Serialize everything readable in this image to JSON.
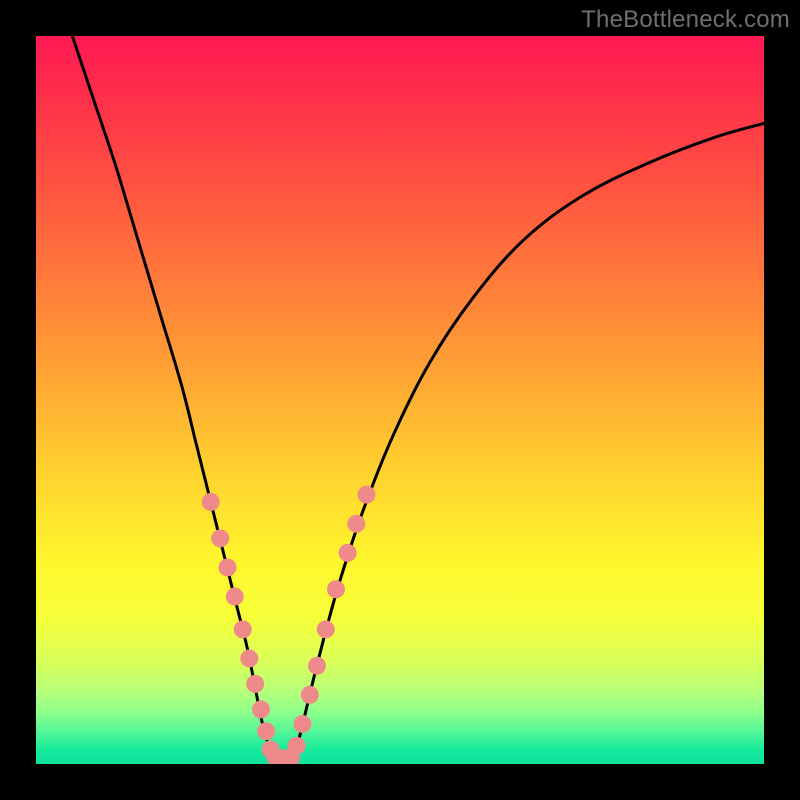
{
  "watermark": "TheBottleneck.com",
  "chart_data": {
    "type": "line",
    "title": "",
    "xlabel": "",
    "ylabel": "",
    "xlim": [
      0,
      100
    ],
    "ylim": [
      0,
      100
    ],
    "grid": false,
    "legend": false,
    "background": "rainbow-gradient",
    "series": [
      {
        "name": "bottleneck-curve-left",
        "x": [
          5,
          8,
          11,
          14,
          17,
          20,
          22,
          24,
          26,
          27.5,
          29,
          30.2,
          31,
          31.8,
          32.4
        ],
        "y": [
          100,
          91,
          82,
          72,
          62,
          52,
          44,
          36,
          28,
          22,
          16,
          10,
          6,
          3,
          0.8
        ]
      },
      {
        "name": "bottleneck-curve-right",
        "x": [
          35.2,
          36,
          37,
          38.2,
          40,
          42,
          45,
          49,
          54,
          60,
          67,
          75,
          84,
          93,
          100
        ],
        "y": [
          0.8,
          3,
          7,
          12,
          19,
          26,
          35,
          45,
          55,
          64,
          72,
          78,
          82.5,
          86,
          88
        ]
      },
      {
        "name": "flat-bottom",
        "x": [
          32.4,
          35.2
        ],
        "y": [
          0.8,
          0.8
        ]
      }
    ],
    "markers": {
      "name": "highlight-dots",
      "color": "#ef8a8a",
      "points": [
        {
          "x": 24.0,
          "y": 36.0
        },
        {
          "x": 25.3,
          "y": 31.0
        },
        {
          "x": 26.3,
          "y": 27.0
        },
        {
          "x": 27.3,
          "y": 23.0
        },
        {
          "x": 28.4,
          "y": 18.5
        },
        {
          "x": 29.3,
          "y": 14.5
        },
        {
          "x": 30.1,
          "y": 11.0
        },
        {
          "x": 30.9,
          "y": 7.5
        },
        {
          "x": 31.6,
          "y": 4.5
        },
        {
          "x": 32.2,
          "y": 2.0
        },
        {
          "x": 32.9,
          "y": 0.9
        },
        {
          "x": 34.0,
          "y": 0.8
        },
        {
          "x": 35.0,
          "y": 0.9
        },
        {
          "x": 35.8,
          "y": 2.5
        },
        {
          "x": 36.6,
          "y": 5.5
        },
        {
          "x": 37.6,
          "y": 9.5
        },
        {
          "x": 38.6,
          "y": 13.5
        },
        {
          "x": 39.8,
          "y": 18.5
        },
        {
          "x": 41.2,
          "y": 24.0
        },
        {
          "x": 42.8,
          "y": 29.0
        },
        {
          "x": 44.0,
          "y": 33.0
        },
        {
          "x": 45.4,
          "y": 37.0
        }
      ]
    }
  }
}
